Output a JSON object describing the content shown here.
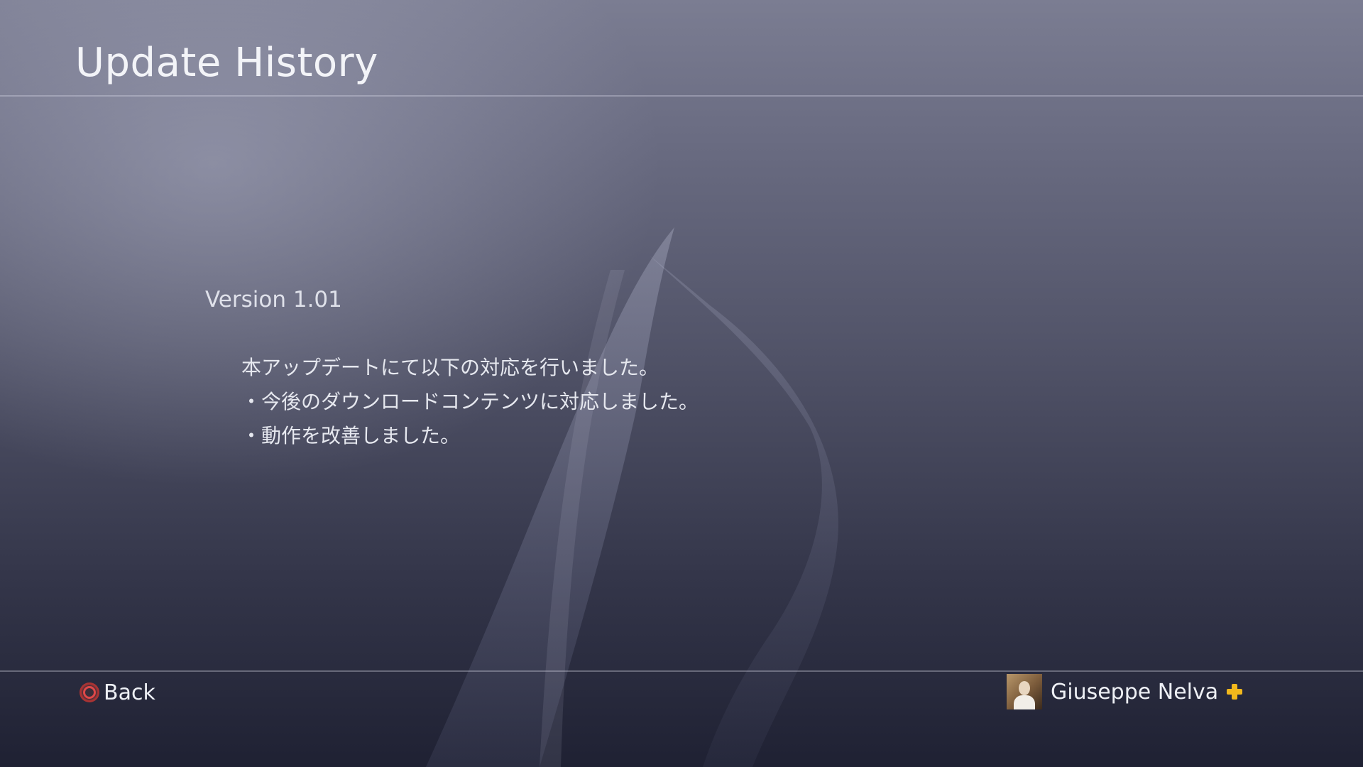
{
  "header": {
    "title": "Update History"
  },
  "content": {
    "version_title": "Version 1.01",
    "notes": [
      "本アップデートにて以下の対応を行いました。",
      "・今後のダウンロードコンテンツに対応しました。",
      "・動作を改善しました。"
    ]
  },
  "footer": {
    "back_label": "Back",
    "back_icon": "circle-button-icon",
    "user_name": "Giuseppe Nelva",
    "plus_icon": "playstation-plus-icon",
    "colors": {
      "circle_button": "#e04848",
      "plus": "#f2b81c"
    }
  }
}
